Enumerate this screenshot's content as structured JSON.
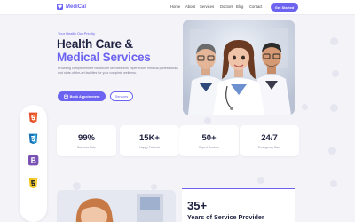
{
  "header": {
    "logo_text": "MediCal",
    "nav": [
      "Home",
      "About",
      "Services",
      "Doctors",
      "Blog",
      "Contact"
    ],
    "cta_label": "Get Started"
  },
  "hero": {
    "eyebrow": "Your Health Our Priority",
    "title_line1": "Health Care &",
    "title_line2": "Medical Services",
    "description": "Providing comprehensive healthcare services with experienced medical professionals and state-of-the-art facilities for your complete wellness.",
    "primary_button": "Book Appointment",
    "secondary_button": "Services"
  },
  "stats": [
    {
      "value": "99%",
      "label": "Success Rate"
    },
    {
      "value": "15K+",
      "label": "Happy Patients"
    },
    {
      "value": "50+",
      "label": "Expert Doctors"
    },
    {
      "value": "24/7",
      "label": "Emergency Care"
    }
  ],
  "tech_badges": [
    "html5-icon",
    "css3-icon",
    "bootstrap-icon",
    "javascript-icon"
  ],
  "about": {
    "number": "35+",
    "caption": "Years of Service Provider"
  },
  "colors": {
    "accent": "#6c63f0",
    "heading": "#1f2140",
    "html5": "#e44d26",
    "css3": "#1572b6",
    "bootstrap": "#7952b3",
    "javascript": "#f0c419"
  }
}
